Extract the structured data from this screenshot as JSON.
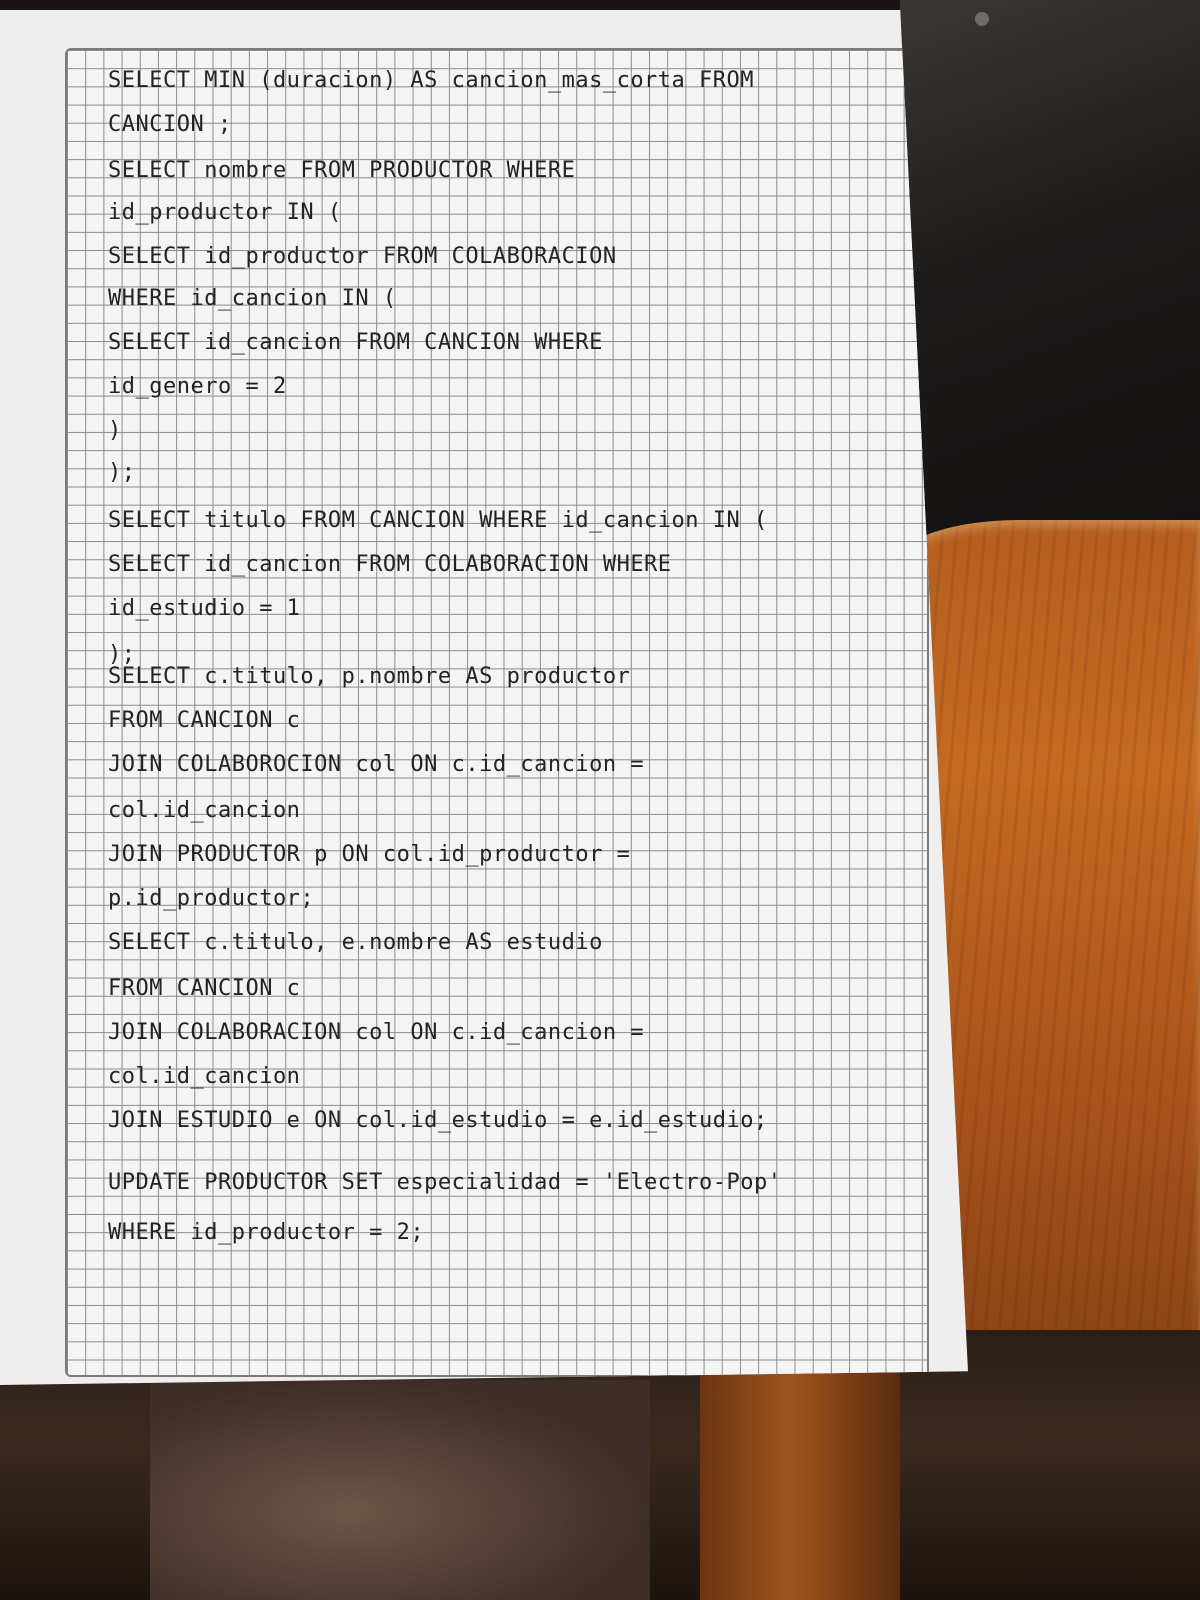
{
  "notebook": {
    "lines": [
      "SELECT MIN (duracion) AS cancion_mas_corta FROM",
      "CANCION ;",
      "SELECT nombre FROM PRODUCTOR WHERE",
      "id_productor IN (",
      "SELECT id_productor FROM COLABORACION",
      "WHERE id_cancion IN (",
      "SELECT id_cancion FROM CANCION WHERE",
      "id_genero = 2",
      ")",
      ");",
      "SELECT titulo FROM CANCION WHERE id_cancion IN (",
      "SELECT id_cancion FROM COLABORACION WHERE",
      "id_estudio = 1",
      ");",
      "SELECT c.titulo, p.nombre AS productor",
      "FROM CANCION c",
      "JOIN COLABOROCION col ON c.id_cancion =",
      "col.id_cancion",
      "JOIN PRODUCTOR p ON col.id_productor =",
      "p.id_productor;",
      "SELECT c.titulo, e.nombre AS estudio",
      "FROM CANCION c",
      "JOIN COLABORACION col ON c.id_cancion =",
      "col.id_cancion",
      "JOIN ESTUDIO e ON col.id_estudio = e.id_estudio;",
      "UPDATE PRODUCTOR SET especialidad = 'Electro-Pop'",
      "WHERE id_productor = 2;"
    ]
  }
}
